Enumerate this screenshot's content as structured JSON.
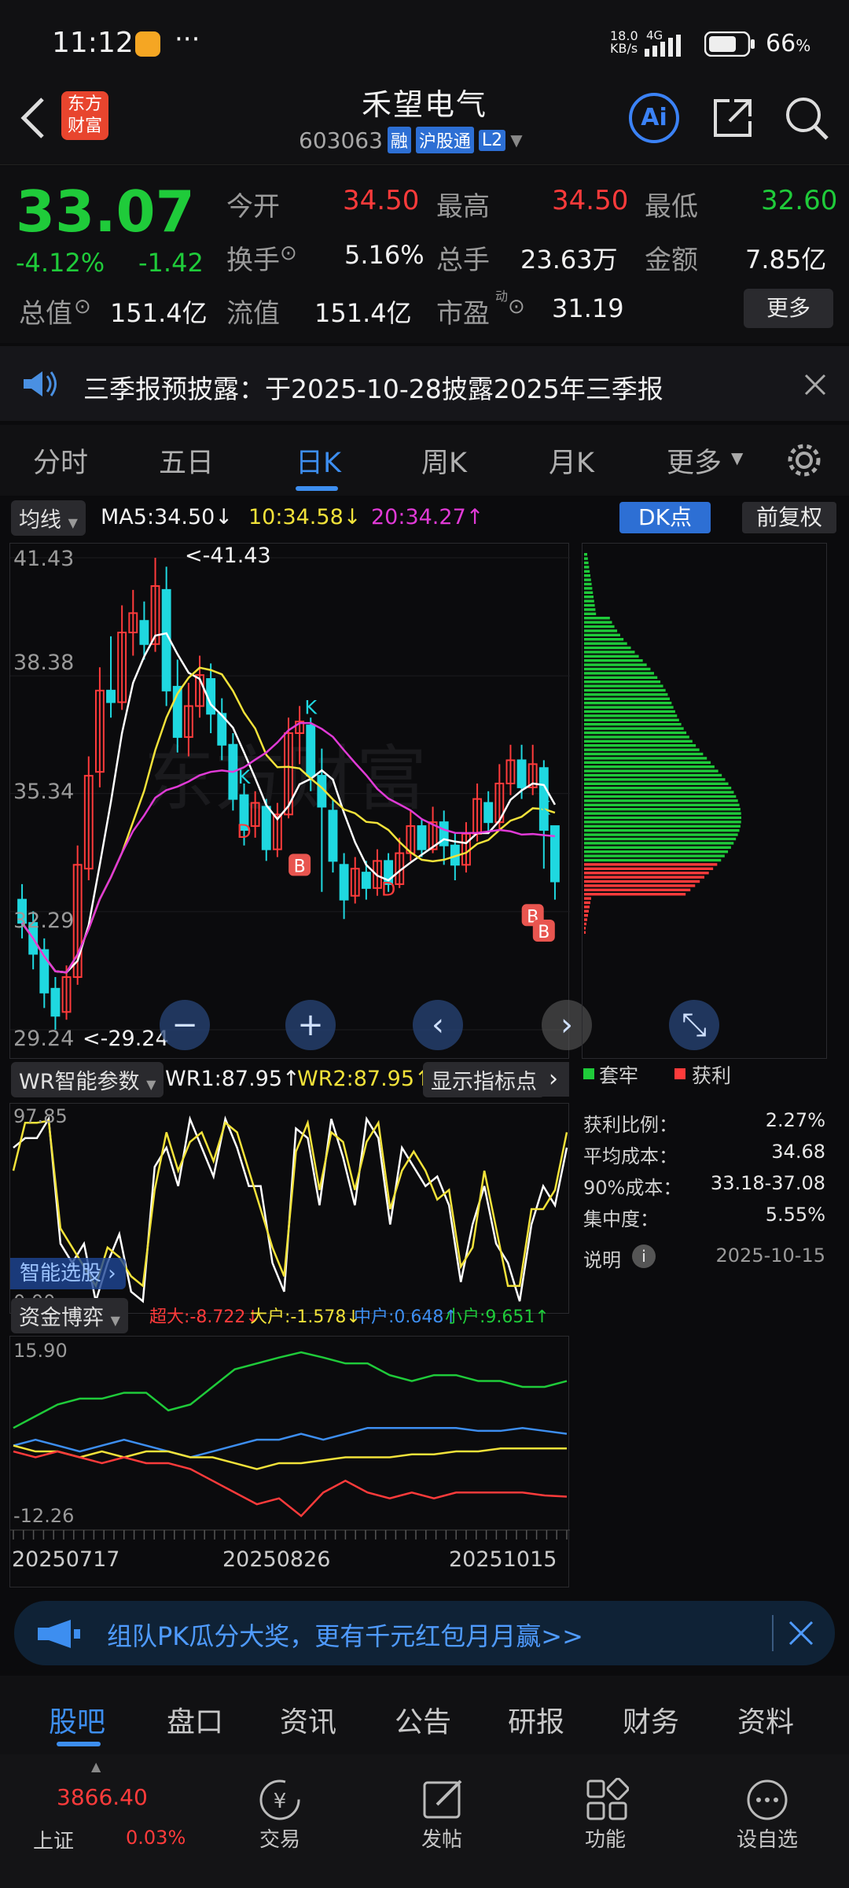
{
  "status_bar": {
    "time": "11:12",
    "dots": "···",
    "net_speed_top": "18.0",
    "net_speed_unit": "KB/s",
    "network": "4G",
    "battery": "66",
    "battery_unit": "%"
  },
  "header": {
    "brand_line1": "东方",
    "brand_line2": "财富",
    "stock_name": "禾望电气",
    "stock_code": "603063",
    "tags": [
      "融",
      "沪股通",
      "L2"
    ],
    "ai_label": "Ai"
  },
  "quote": {
    "price": "33.07",
    "change_pct": "-4.12%",
    "change_amt": "-1.42",
    "open_label": "今开",
    "open_value": "34.50",
    "high_label": "最高",
    "high_value": "34.50",
    "low_label": "最低",
    "low_value": "32.60",
    "turnover_label": "换手",
    "turnover_value": "5.16%",
    "volume_label": "总手",
    "volume_value": "23.63万",
    "amount_label": "金额",
    "amount_value": "7.85亿",
    "mktcap_label": "总值",
    "mktcap_value": "151.4亿",
    "float_label": "流值",
    "float_value": "151.4亿",
    "pe_label": "市盈",
    "pe_sup": "动",
    "pe_value": "31.19",
    "more_button": "更多"
  },
  "notice": {
    "text": "三季报预披露：于2025-10-28披露2025年三季报"
  },
  "tabs": [
    "分时",
    "五日",
    "日K",
    "周K",
    "月K",
    "更多"
  ],
  "active_tab": "日K",
  "ma_bar": {
    "selector": "均线",
    "ma5": "MA5:34.50",
    "ma10": "10:34.58",
    "ma20": "20:34.27",
    "dk_button": "DK点",
    "adjust_button": "前复权"
  },
  "kline": {
    "y_labels": [
      "41.43",
      "38.38",
      "35.34",
      "32.29",
      "29.24"
    ],
    "max_marker": "<-41.43",
    "min_marker": "<-29.24",
    "watermark": "东方财富"
  },
  "wr_bar": {
    "selector": "WR智能参数",
    "wr1": "WR1:87.95",
    "wr2": "WR2:87.95",
    "show_points": "显示指标点",
    "y_top": "97.85",
    "y_bottom": "0.00",
    "smart_pick": "智能选股"
  },
  "fund_bar": {
    "selector": "资金博弈",
    "super_large": "超大:-8.722",
    "large": "大户:-1.578",
    "medium": "中户:0.648",
    "small": "小户:9.651",
    "y_top": "15.90",
    "y_bottom": "-12.26"
  },
  "dates": [
    "20250717",
    "20250826",
    "20251015"
  ],
  "chip": {
    "legend_trapped": "套牢",
    "legend_profit": "获利",
    "profit_ratio_label": "获利比例：",
    "profit_ratio": "2.27%",
    "avg_cost_label": "平均成本：",
    "avg_cost": "34.68",
    "cost90_label": "90%成本：",
    "cost90": "33.18-37.08",
    "concentration_label": "集中度：",
    "concentration": "5.55%",
    "explain_label": "说明",
    "date": "2025-10-15"
  },
  "banner": {
    "text": "组队PK瓜分大奖，更有千元红包月月赢>>"
  },
  "bottom_tabs": [
    "股吧",
    "盘口",
    "资讯",
    "公告",
    "研报",
    "财务",
    "资料"
  ],
  "active_bottom_tab": "股吧",
  "nav": {
    "index_value": "3866.40",
    "index_name": "上证",
    "index_change": "0.03%",
    "items": [
      "交易",
      "发帖",
      "功能",
      "设自选"
    ]
  },
  "chart_data": {
    "type": "candlestick",
    "y_range": [
      29.24,
      41.43
    ],
    "y_ticks": [
      41.43,
      38.38,
      35.34,
      32.29,
      29.24
    ],
    "candles": [
      {
        "o": 32.6,
        "c": 32.0,
        "h": 33.0,
        "l": 31.6
      },
      {
        "o": 32.0,
        "c": 31.2,
        "h": 32.3,
        "l": 30.8
      },
      {
        "o": 31.3,
        "c": 30.2,
        "h": 31.6,
        "l": 29.8
      },
      {
        "o": 30.3,
        "c": 29.6,
        "h": 30.6,
        "l": 29.24
      },
      {
        "o": 29.7,
        "c": 30.6,
        "h": 30.9,
        "l": 29.5
      },
      {
        "o": 30.6,
        "c": 33.5,
        "h": 34.0,
        "l": 30.4
      },
      {
        "o": 33.4,
        "c": 35.8,
        "h": 36.3,
        "l": 33.1
      },
      {
        "o": 35.9,
        "c": 38.0,
        "h": 38.6,
        "l": 35.5
      },
      {
        "o": 38.0,
        "c": 37.7,
        "h": 39.4,
        "l": 37.3
      },
      {
        "o": 37.7,
        "c": 39.5,
        "h": 40.2,
        "l": 37.5
      },
      {
        "o": 39.5,
        "c": 40.0,
        "h": 40.6,
        "l": 38.9
      },
      {
        "o": 39.8,
        "c": 39.2,
        "h": 40.3,
        "l": 38.8
      },
      {
        "o": 39.2,
        "c": 40.7,
        "h": 41.43,
        "l": 39.0
      },
      {
        "o": 40.6,
        "c": 38.0,
        "h": 41.2,
        "l": 37.6
      },
      {
        "o": 38.1,
        "c": 36.8,
        "h": 38.8,
        "l": 36.4
      },
      {
        "o": 36.8,
        "c": 37.6,
        "h": 38.2,
        "l": 36.3
      },
      {
        "o": 37.6,
        "c": 38.4,
        "h": 38.9,
        "l": 37.3
      },
      {
        "o": 38.3,
        "c": 37.4,
        "h": 38.7,
        "l": 36.9
      },
      {
        "o": 37.4,
        "c": 36.6,
        "h": 37.8,
        "l": 36.2
      },
      {
        "o": 36.6,
        "c": 35.2,
        "h": 36.9,
        "l": 34.9
      },
      {
        "o": 35.3,
        "c": 34.4,
        "h": 35.6,
        "l": 34.0
      },
      {
        "o": 34.5,
        "c": 35.1,
        "h": 35.4,
        "l": 34.2
      },
      {
        "o": 35.0,
        "c": 33.9,
        "h": 35.2,
        "l": 33.6
      },
      {
        "o": 33.9,
        "c": 34.8,
        "h": 35.1,
        "l": 33.7
      },
      {
        "o": 34.8,
        "c": 36.9,
        "h": 37.3,
        "l": 34.7
      },
      {
        "o": 36.9,
        "c": 37.2,
        "h": 37.6,
        "l": 36.1
      },
      {
        "o": 37.1,
        "c": 35.8,
        "h": 37.3,
        "l": 35.4
      },
      {
        "o": 35.8,
        "c": 35.0,
        "h": 36.5,
        "l": 32.8
      },
      {
        "o": 34.9,
        "c": 33.6,
        "h": 35.2,
        "l": 33.3
      },
      {
        "o": 33.5,
        "c": 32.6,
        "h": 33.8,
        "l": 32.1
      },
      {
        "o": 32.7,
        "c": 33.4,
        "h": 33.7,
        "l": 32.5
      },
      {
        "o": 33.3,
        "c": 32.9,
        "h": 33.6,
        "l": 32.6
      },
      {
        "o": 32.9,
        "c": 33.6,
        "h": 33.9,
        "l": 32.7
      },
      {
        "o": 33.6,
        "c": 33.0,
        "h": 33.8,
        "l": 32.8
      },
      {
        "o": 33.0,
        "c": 33.8,
        "h": 34.2,
        "l": 32.9
      },
      {
        "o": 33.8,
        "c": 34.5,
        "h": 34.9,
        "l": 33.6
      },
      {
        "o": 34.5,
        "c": 33.9,
        "h": 34.7,
        "l": 33.7
      },
      {
        "o": 33.9,
        "c": 34.6,
        "h": 35.0,
        "l": 33.8
      },
      {
        "o": 34.6,
        "c": 34.0,
        "h": 34.9,
        "l": 33.5
      },
      {
        "o": 34.0,
        "c": 33.5,
        "h": 34.3,
        "l": 33.1
      },
      {
        "o": 33.5,
        "c": 34.3,
        "h": 34.6,
        "l": 33.3
      },
      {
        "o": 34.3,
        "c": 35.2,
        "h": 35.6,
        "l": 34.1
      },
      {
        "o": 35.1,
        "c": 34.6,
        "h": 35.4,
        "l": 34.3
      },
      {
        "o": 34.6,
        "c": 35.6,
        "h": 36.1,
        "l": 34.4
      },
      {
        "o": 35.6,
        "c": 36.2,
        "h": 36.6,
        "l": 35.3
      },
      {
        "o": 36.2,
        "c": 35.5,
        "h": 36.6,
        "l": 35.2
      },
      {
        "o": 35.5,
        "c": 36.1,
        "h": 36.6,
        "l": 35.3
      },
      {
        "o": 36.0,
        "c": 34.4,
        "h": 36.2,
        "l": 33.4
      },
      {
        "o": 34.5,
        "c": 33.07,
        "h": 34.5,
        "l": 32.6
      }
    ],
    "markers": [
      "B",
      "B",
      "B",
      "D",
      "D",
      "K",
      "K",
      "K"
    ]
  }
}
